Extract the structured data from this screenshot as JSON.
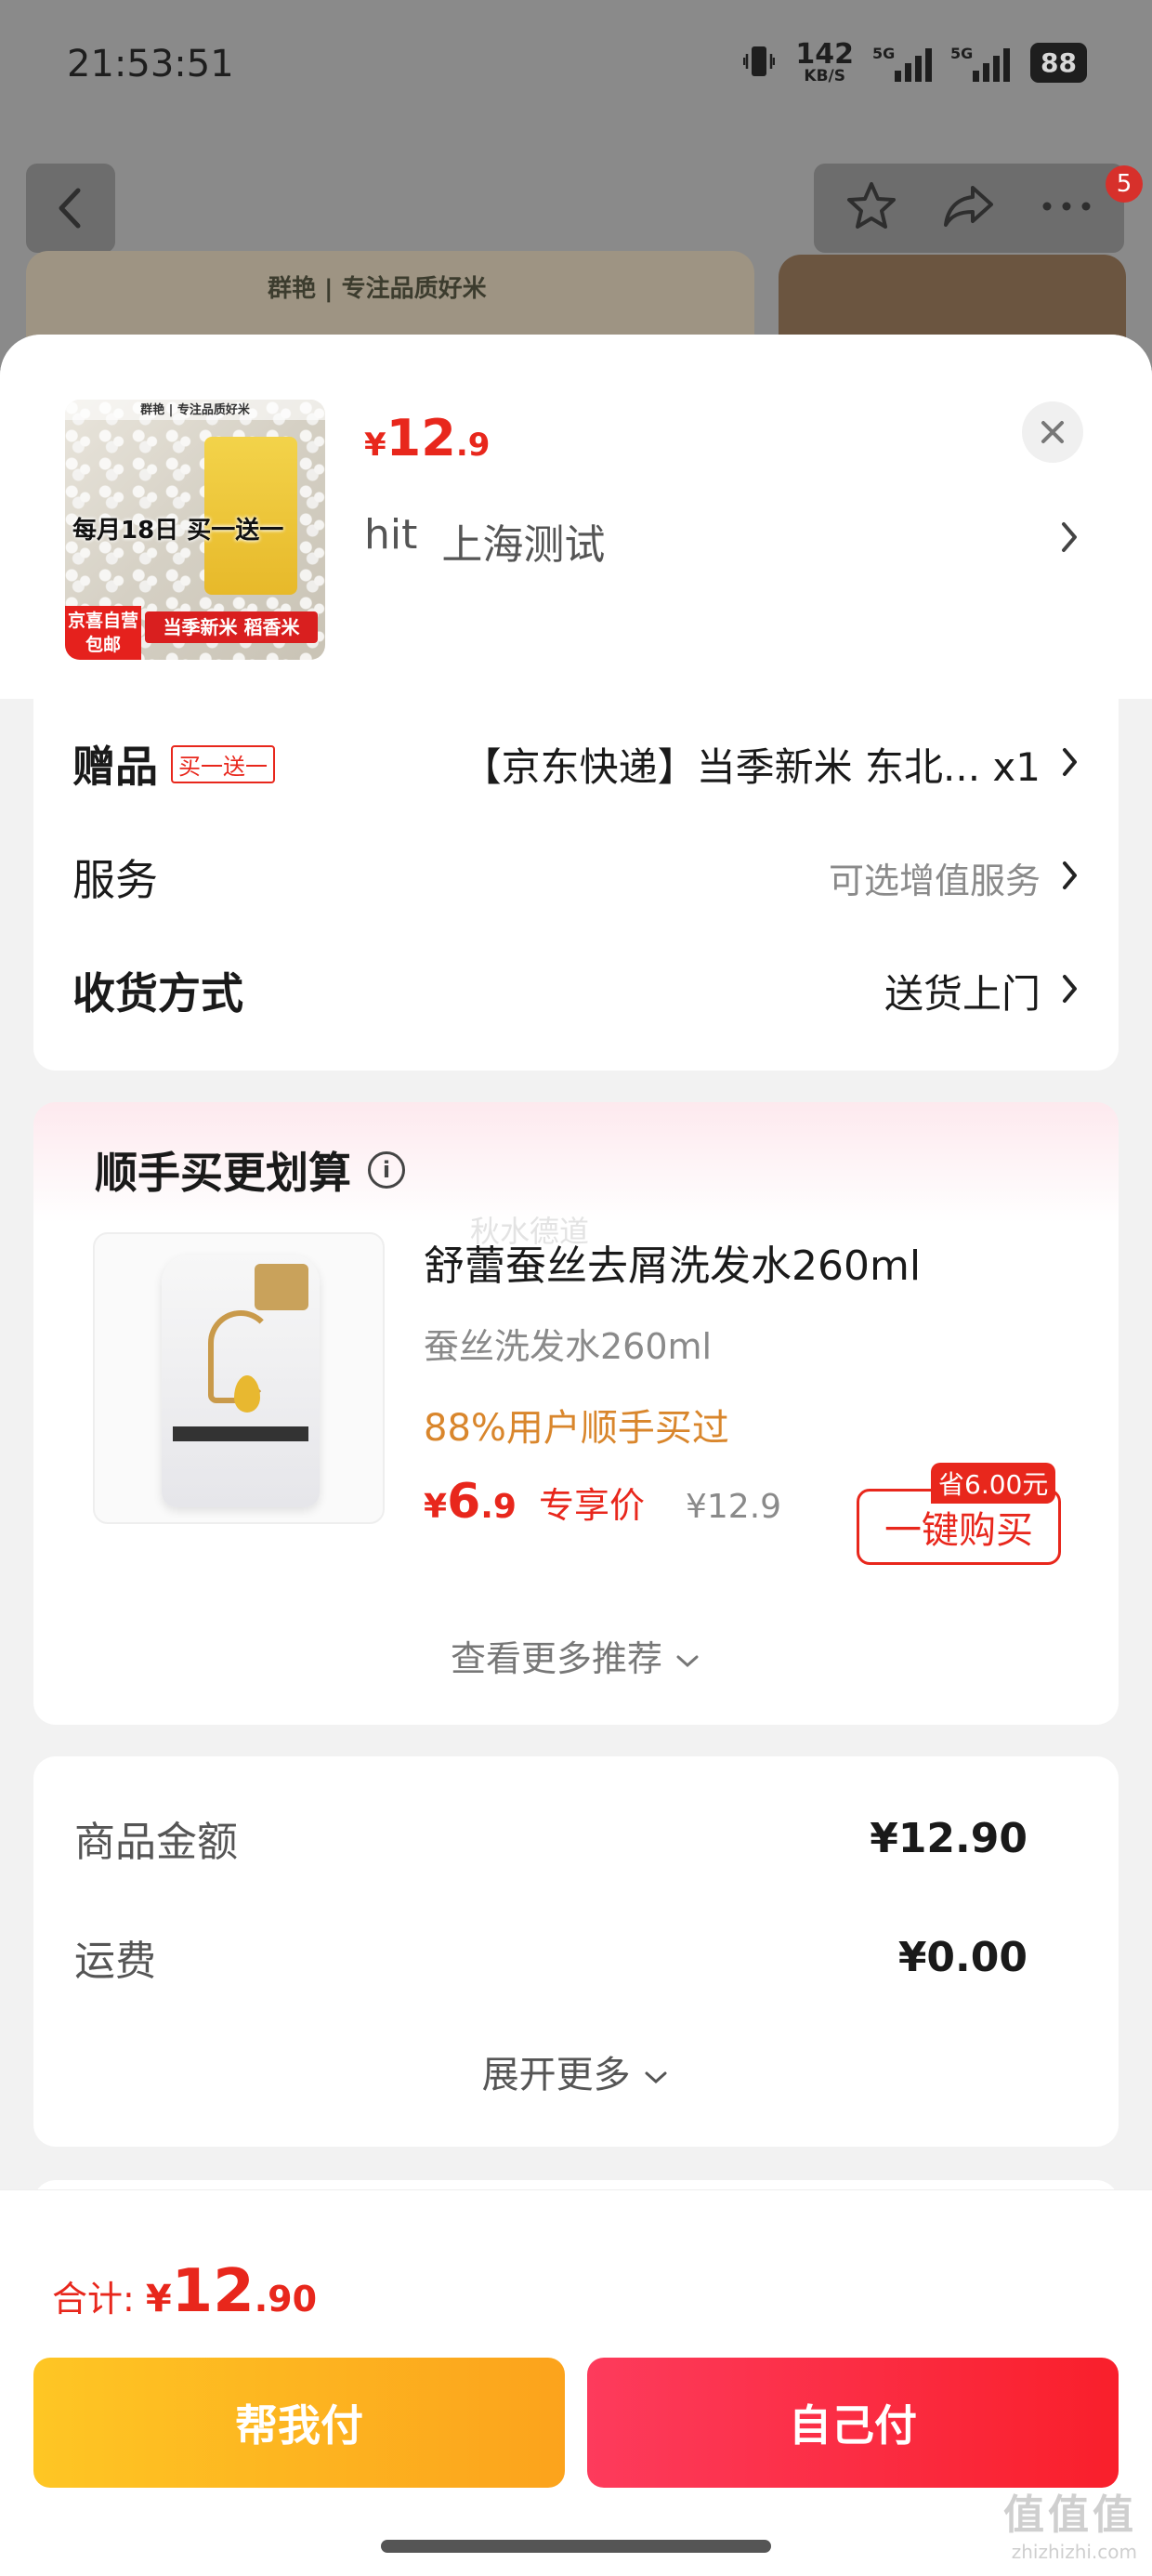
{
  "status_bar": {
    "time": "21:53:51",
    "net_speed_value": "142",
    "net_speed_unit": "KB/S",
    "signal1_label": "5G",
    "signal2_label": "5G",
    "battery": "88"
  },
  "background": {
    "notification_count": "5",
    "brand_text": "群艳 | 专注品质好米"
  },
  "product": {
    "price_currency": "¥",
    "price_int": "12",
    "price_dec": ".9",
    "address_user": "hit",
    "address_text": "上海测试",
    "thumb_brand": "群艳 | 专注品质好米",
    "thumb_promo": "每月18日 买一送一",
    "thumb_badge": "京喜自营 包邮",
    "thumb_strip": "当季新米 稻香米"
  },
  "options": {
    "gift_label": "赠品",
    "gift_tag": "买一送一",
    "gift_value": "【京东快递】当季新米 东北... x1",
    "service_label": "服务",
    "service_value": "可选增值服务",
    "delivery_label": "收货方式",
    "delivery_value": "送货上门"
  },
  "recommend": {
    "title": "顺手买更划算",
    "info_glyph": "i",
    "watermark": "秋水德道",
    "item_name": "舒蕾蚕丝去屑洗发水260ml",
    "item_spec": "蚕丝洗发水260ml",
    "item_stat": "88%用户顺手买过",
    "price_currency": "¥",
    "price_int": "6",
    "price_dec": ".9",
    "price_tag": "专享价",
    "original_price": "¥12.9",
    "save_tag": "省6.00元",
    "buy_button": "一键购买",
    "more_link": "查看更多推荐"
  },
  "amounts": {
    "goods_label": "商品金额",
    "goods_value": "¥12.90",
    "shipping_label": "运费",
    "shipping_value": "¥0.00",
    "expand_link": "展开更多"
  },
  "footer": {
    "total_label": "合计:",
    "total_currency": "¥",
    "total_int": "12",
    "total_dec": ".90",
    "pay_friend_button": "帮我付",
    "pay_self_button": "自己付"
  },
  "watermark": {
    "main": "值值值",
    "sub": "zhizhizhi.com"
  },
  "colors": {
    "accent_red": "#e8271c",
    "friend_pay_yellow": "#fdb420",
    "self_pay_red": "#fb2c42",
    "recommend_stat_orange": "#d9862c"
  }
}
